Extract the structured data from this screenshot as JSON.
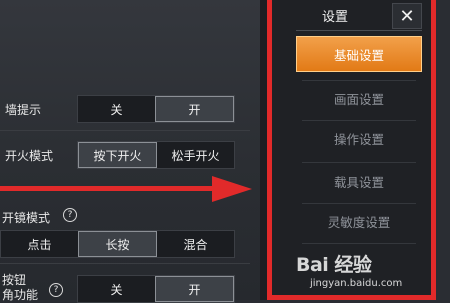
{
  "settings": {
    "row1": {
      "label": "墙提示",
      "options": [
        "关",
        "开"
      ],
      "selected": "开"
    },
    "row2": {
      "label": "开火模式",
      "options": [
        "按下开火",
        "松手开火"
      ],
      "selected": "按下开火"
    },
    "row3": {
      "label": "开镜模式",
      "help": "?",
      "options": [
        "点击",
        "长按",
        "混合"
      ],
      "selected": "长按"
    },
    "row4": {
      "label_line1": "按钮",
      "label_line2": "角功能",
      "help": "?",
      "options": [
        "关",
        "开"
      ],
      "selected": "开"
    }
  },
  "menu": {
    "title": "设置",
    "close_glyph": "✕",
    "items": [
      "基础设置",
      "画面设置",
      "操作设置",
      "载具设置",
      "灵敏度设置"
    ],
    "active": "基础设置"
  },
  "watermark": {
    "brand": "Bai 经验",
    "url": "jingyan.baidu.com"
  },
  "colors": {
    "accent": "#e27a16",
    "annotation": "#e12a2a"
  }
}
